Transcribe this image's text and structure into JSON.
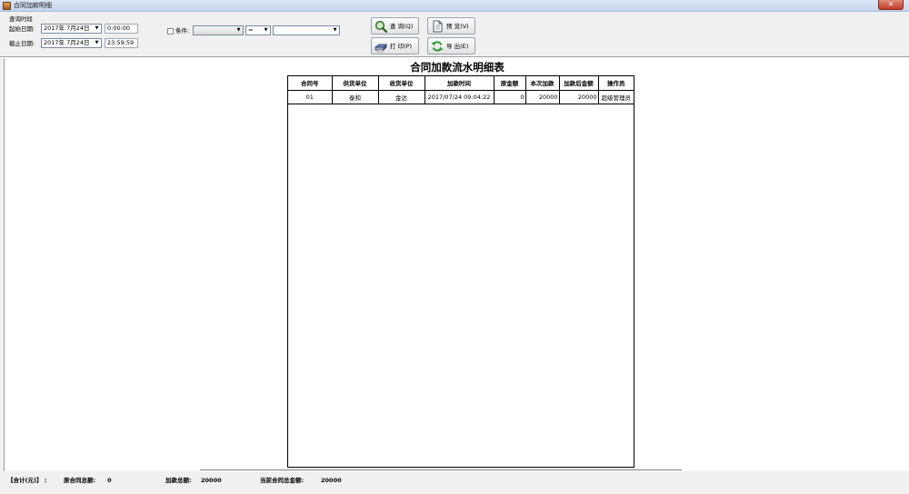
{
  "window": {
    "title": "合同加款明细",
    "close_glyph": "✕"
  },
  "query": {
    "group_label": "查询时段",
    "start_label": "起始日期:",
    "start_date": "2017年 7月24日",
    "start_time": "0:00:00",
    "end_label": "截止日期:",
    "end_date": "2017年 7月24日",
    "end_time": "23:59:59",
    "condition_label": "条件:",
    "condition_field": "",
    "condition_operator": "=",
    "condition_value": ""
  },
  "toolbar": {
    "query": "查 询(Q)",
    "preview": "预 览(V)",
    "print": "打 印(P)",
    "export": "导 出(E)"
  },
  "report": {
    "title": "合同加款流水明细表",
    "columns": [
      "合同号",
      "供货单位",
      "收货单位",
      "加款时间",
      "原金额",
      "本次加款",
      "加款后金额",
      "操作员"
    ],
    "rows": [
      [
        "01",
        "泰和",
        "金达",
        "2017/07/24 09:04:22",
        "0",
        "20000",
        "20000",
        "超级管理员"
      ]
    ]
  },
  "summary": {
    "total_label": "【合计(元)】 :",
    "orig_label": "原合同总额:",
    "orig_value": "0",
    "add_label": "加款总额:",
    "add_value": "20000",
    "current_label": "当前合同总金额:",
    "current_value": "20000"
  },
  "icons": {
    "query": "magnifier-icon",
    "preview": "document-icon",
    "print": "printer-icon",
    "export": "refresh-export-icon"
  }
}
